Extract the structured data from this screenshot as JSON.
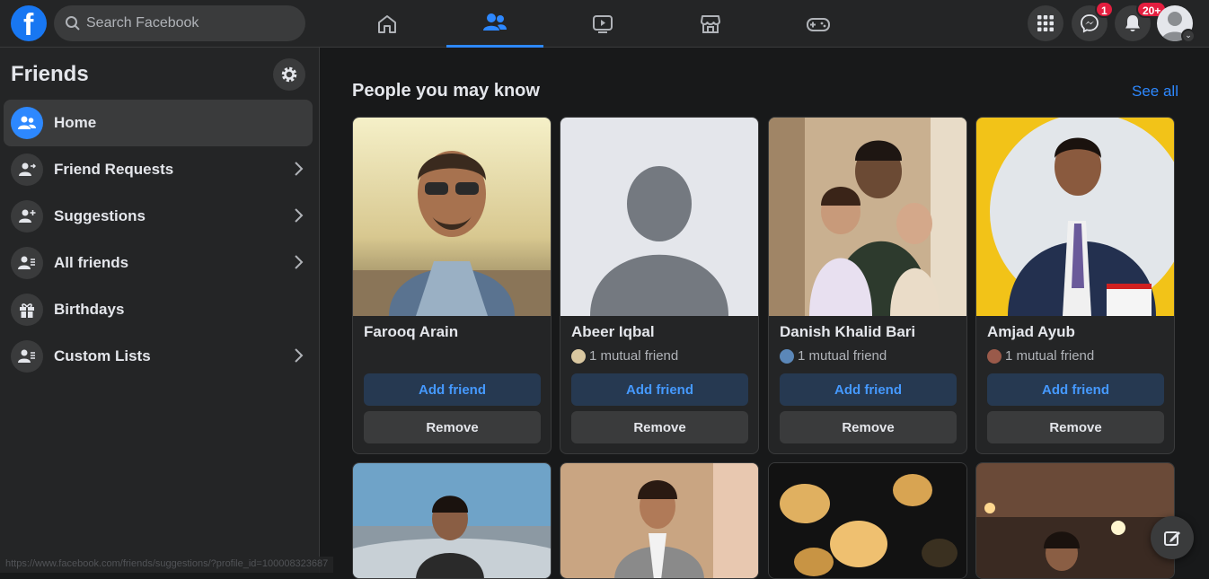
{
  "topbar": {
    "logo_letter": "f",
    "search_placeholder": "Search Facebook",
    "nav_tabs": [
      {
        "icon": "home-icon"
      },
      {
        "icon": "friends-icon",
        "active": true
      },
      {
        "icon": "watch-icon"
      },
      {
        "icon": "marketplace-icon"
      },
      {
        "icon": "gaming-icon"
      }
    ],
    "messenger_badge": "1",
    "notifications_badge": "20+"
  },
  "sidebar": {
    "title": "Friends",
    "items": [
      {
        "label": "Home",
        "icon": "friends-icon",
        "active": true,
        "chevron": false
      },
      {
        "label": "Friend Requests",
        "icon": "friend-request-icon",
        "chevron": true
      },
      {
        "label": "Suggestions",
        "icon": "add-friend-icon",
        "chevron": true
      },
      {
        "label": "All friends",
        "icon": "friend-list-icon",
        "chevron": true
      },
      {
        "label": "Birthdays",
        "icon": "gift-icon",
        "chevron": false
      },
      {
        "label": "Custom Lists",
        "icon": "custom-list-icon",
        "chevron": true
      }
    ]
  },
  "main": {
    "section_title": "People you may know",
    "see_all": "See all",
    "cards": [
      {
        "name": "Farooq Arain",
        "mutual": "",
        "add_label": "Add friend",
        "remove_label": "Remove"
      },
      {
        "name": "Abeer Iqbal",
        "mutual": "1 mutual friend",
        "add_label": "Add friend",
        "remove_label": "Remove"
      },
      {
        "name": "Danish Khalid Bari",
        "mutual": "1 mutual friend",
        "add_label": "Add friend",
        "remove_label": "Remove"
      },
      {
        "name": "Amjad Ayub",
        "mutual": "1 mutual friend",
        "add_label": "Add friend",
        "remove_label": "Remove"
      }
    ]
  },
  "status_url": "https://www.facebook.com/friends/suggestions/?profile_id=100008323687",
  "colors": {
    "accent": "#2d88ff",
    "background": "#18191a",
    "surface": "#242526",
    "badge": "#e41e3f"
  }
}
